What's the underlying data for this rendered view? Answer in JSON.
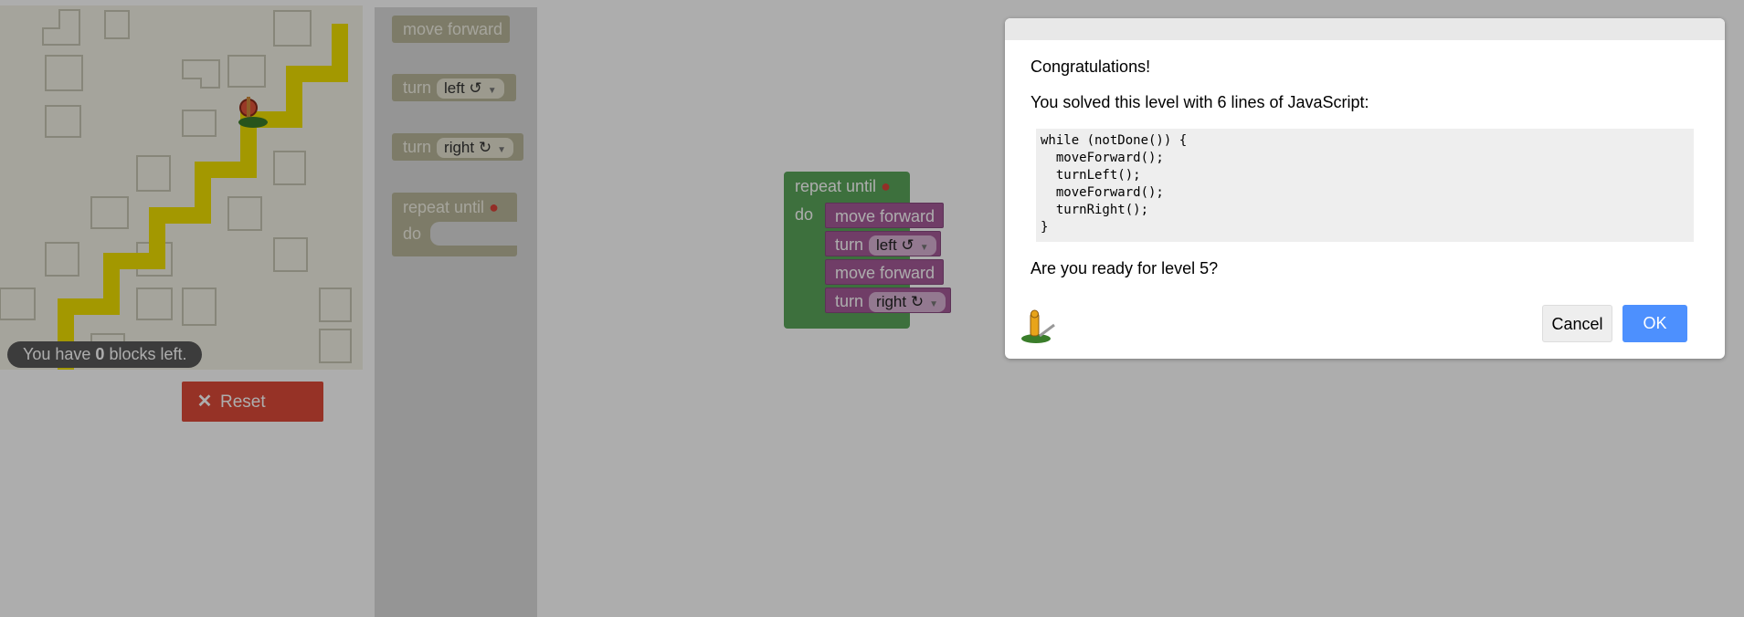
{
  "maze": {
    "capacity_prefix": "You have ",
    "capacity_count": "0",
    "capacity_suffix": " blocks left."
  },
  "reset": {
    "label": "Reset",
    "icon": "close-icon"
  },
  "toolbox": {
    "move_forward": "move forward",
    "turn_label": "turn",
    "turn_left_option": "left ↺",
    "turn_right_option": "right ↻",
    "repeat_until": "repeat until",
    "do_label": "do"
  },
  "program": {
    "repeat_until": "repeat until",
    "do_label": "do",
    "blocks": [
      {
        "label": "move forward"
      },
      {
        "label": "turn",
        "option": "left ↺"
      },
      {
        "label": "move forward"
      },
      {
        "label": "turn",
        "option": "right ↻"
      }
    ]
  },
  "dialog": {
    "title": "Congratulations!",
    "message": "You solved this level with 6 lines of JavaScript:",
    "code_lines": [
      "while (notDone()) {",
      "  moveForward();",
      "  turnLeft();",
      "  moveForward();",
      "  turnRight();",
      "}"
    ],
    "question": "Are you ready for level 5?",
    "cancel_label": "Cancel",
    "ok_label": "OK"
  },
  "colors": {
    "path": "#f0e100",
    "loop_block": "#5ba55b",
    "action_block": "#a55b99",
    "reset": "#dd4b39",
    "ok": "#4d90fe"
  }
}
